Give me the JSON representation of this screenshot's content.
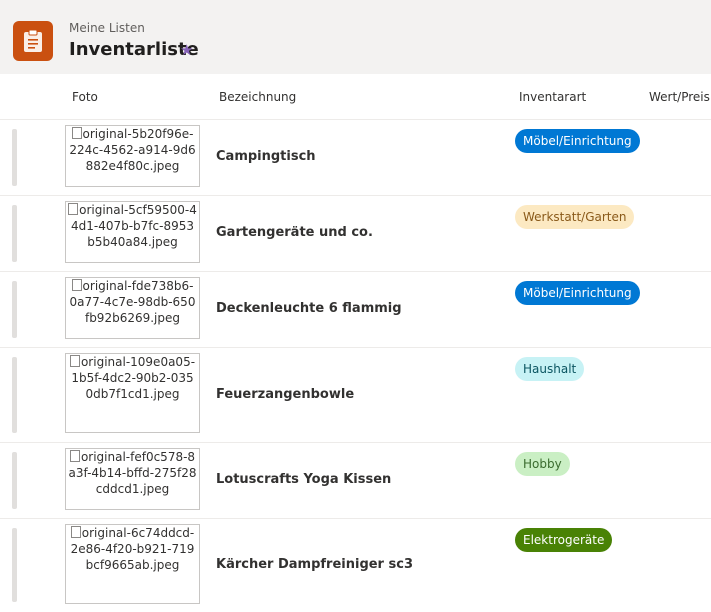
{
  "header": {
    "breadcrumb_parent": "Meine Listen",
    "title": "Inventarliste",
    "favorite_icon": "star-icon",
    "app_icon": "clipboard-icon",
    "accent_color": "#ca5010"
  },
  "columns": {
    "photo": "Foto",
    "name": "Bezeichnung",
    "type": "Inventarart",
    "value": "Wert/Preis"
  },
  "rows": [
    {
      "photo_alt": "original-5b20f96e-224c-4562-a914-9d6882e4f80c.jpeg",
      "name": "Campingtisch",
      "type": "Möbel/Einrichtung",
      "type_bg": "#0078d4",
      "type_fg": "#ffffff"
    },
    {
      "photo_alt": "original-5cf59500-44d1-407b-b7fc-8953b5b40a84.jpeg",
      "name": "Gartengeräte und co.",
      "type": "Werkstatt/Garten",
      "type_bg": "#fce9c2",
      "type_fg": "#8a5a1a"
    },
    {
      "photo_alt": "original-fde738b6-0a77-4c7e-98db-650fb92b6269.jpeg",
      "name": "Deckenleuchte 6 flammig",
      "type": "Möbel/Einrichtung",
      "type_bg": "#0078d4",
      "type_fg": "#ffffff"
    },
    {
      "photo_alt": "original-109e0a05-1b5f-4dc2-90b2-0350db7f1cd1.jpeg",
      "name": "Feuerzangenbowle",
      "type": "Haushalt",
      "type_bg": "#c7f2f5",
      "type_fg": "#0b5561"
    },
    {
      "photo_alt": "original-fef0c578-8a3f-4b14-bffd-275f28cddcd1.jpeg",
      "name": "Lotuscrafts Yoga Kissen",
      "type": "Hobby",
      "type_bg": "#caefc4",
      "type_fg": "#3a6b2e"
    },
    {
      "photo_alt": "original-6c74ddcd-2e86-4f20-b921-719bcf9665ab.jpeg",
      "name": "Kärcher Dampfreiniger sc3",
      "type": "Elektrogeräte",
      "type_bg": "#498205",
      "type_fg": "#ffffff"
    }
  ]
}
